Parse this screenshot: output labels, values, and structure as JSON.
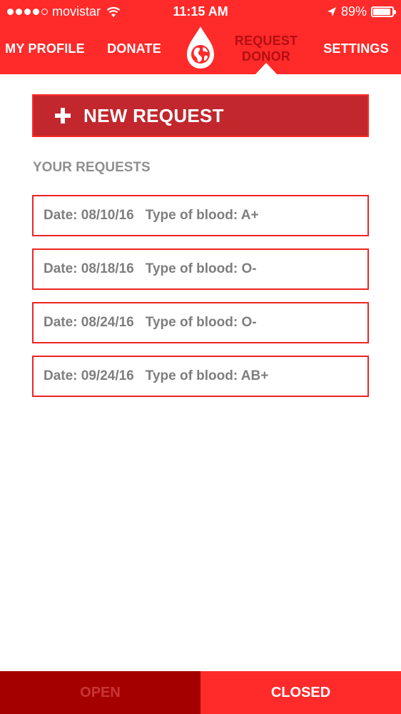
{
  "status_bar": {
    "carrier": "movistar",
    "time": "11:15 AM",
    "battery": "89%",
    "signal_bars_filled": 4,
    "signal_bars_total": 5
  },
  "nav": {
    "my_profile": "MY PROFILE",
    "donate": "DONATE",
    "request_donor_line1": "REQUEST",
    "request_donor_line2": "DONOR",
    "settings": "SETTINGS"
  },
  "new_request": {
    "label": "NEW REQUEST"
  },
  "requests": {
    "title": "YOUR REQUESTS",
    "items": [
      {
        "date": "Date: 08/10/16",
        "blood": "Type of blood: A+"
      },
      {
        "date": "Date: 08/18/16",
        "blood": "Type of blood: O-"
      },
      {
        "date": "Date: 08/24/16",
        "blood": "Type of blood: O-"
      },
      {
        "date": "Date: 09/24/16",
        "blood": "Type of blood: AB+"
      }
    ]
  },
  "bottom_tabs": {
    "open": "OPEN",
    "closed": "CLOSED"
  },
  "colors": {
    "brand_red": "#ff2a2a",
    "button_dark_red": "#c1272d",
    "open_tab_bg": "#a50000",
    "text_gray": "#8f8f8f"
  }
}
